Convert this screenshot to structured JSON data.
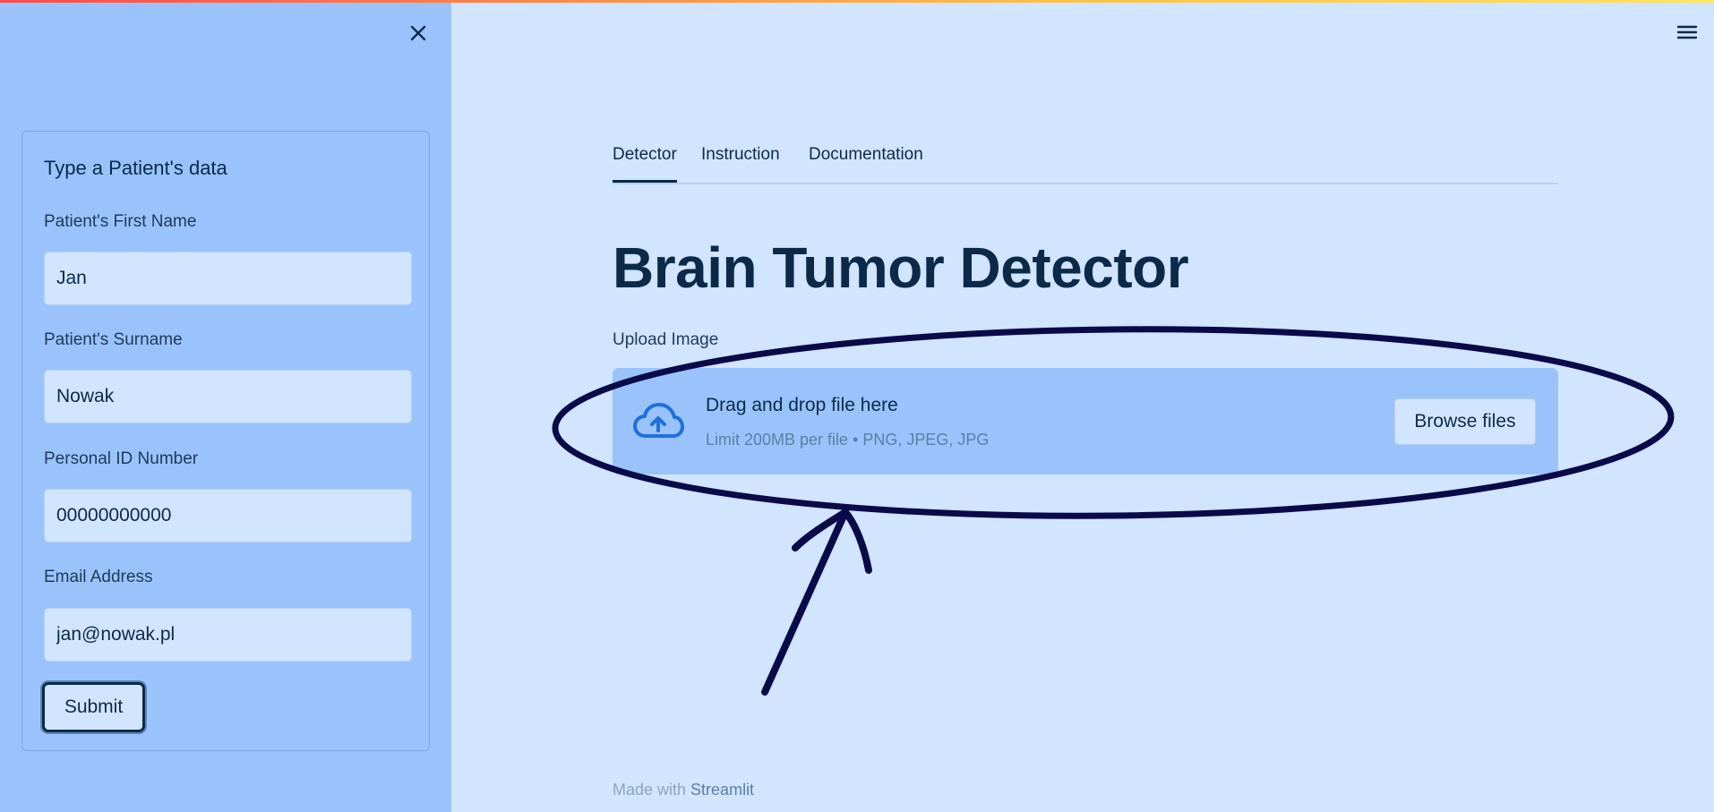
{
  "sidebar": {
    "form_title": "Type a Patient's data",
    "fields": [
      {
        "label": "Patient's First Name",
        "value": "Jan"
      },
      {
        "label": "Patient's Surname",
        "value": "Nowak"
      },
      {
        "label": "Personal ID Number",
        "value": "00000000000"
      },
      {
        "label": "Email Address",
        "value": "jan@nowak.pl"
      }
    ],
    "submit_label": "Submit"
  },
  "main": {
    "tabs": [
      {
        "label": "Detector",
        "active": true
      },
      {
        "label": "Instruction",
        "active": false
      },
      {
        "label": "Documentation",
        "active": false
      }
    ],
    "title": "Brain Tumor Detector",
    "upload": {
      "label": "Upload Image",
      "drop_text": "Drag and drop file here",
      "limit_text": "Limit 200MB per file • PNG, JPEG, JPG",
      "browse_label": "Browse files"
    }
  },
  "footer": {
    "prefix": "Made with ",
    "brand": "Streamlit"
  },
  "icons": {
    "close": "close-icon",
    "menu": "hamburger-menu-icon",
    "upload": "cloud-upload-icon"
  },
  "colors": {
    "background": "#d2e5fe",
    "sidebar": "#9ac3fb",
    "text": "#0b2a4a",
    "annotation": "#0a0a4a"
  }
}
